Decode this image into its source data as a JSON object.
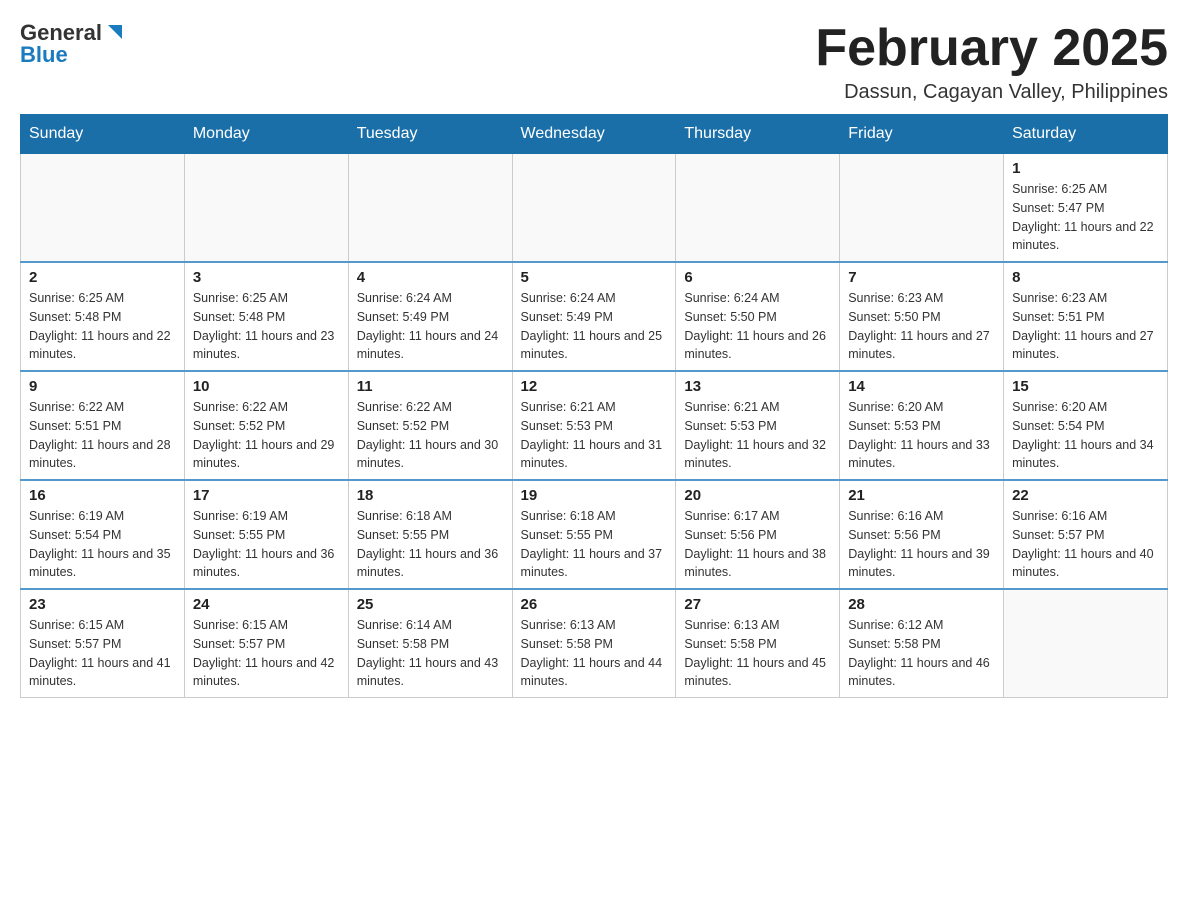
{
  "header": {
    "logo_general": "General",
    "logo_blue": "Blue",
    "month_title": "February 2025",
    "location": "Dassun, Cagayan Valley, Philippines"
  },
  "days_of_week": [
    "Sunday",
    "Monday",
    "Tuesday",
    "Wednesday",
    "Thursday",
    "Friday",
    "Saturday"
  ],
  "weeks": [
    [
      {
        "day": "",
        "info": ""
      },
      {
        "day": "",
        "info": ""
      },
      {
        "day": "",
        "info": ""
      },
      {
        "day": "",
        "info": ""
      },
      {
        "day": "",
        "info": ""
      },
      {
        "day": "",
        "info": ""
      },
      {
        "day": "1",
        "info": "Sunrise: 6:25 AM\nSunset: 5:47 PM\nDaylight: 11 hours and 22 minutes."
      }
    ],
    [
      {
        "day": "2",
        "info": "Sunrise: 6:25 AM\nSunset: 5:48 PM\nDaylight: 11 hours and 22 minutes."
      },
      {
        "day": "3",
        "info": "Sunrise: 6:25 AM\nSunset: 5:48 PM\nDaylight: 11 hours and 23 minutes."
      },
      {
        "day": "4",
        "info": "Sunrise: 6:24 AM\nSunset: 5:49 PM\nDaylight: 11 hours and 24 minutes."
      },
      {
        "day": "5",
        "info": "Sunrise: 6:24 AM\nSunset: 5:49 PM\nDaylight: 11 hours and 25 minutes."
      },
      {
        "day": "6",
        "info": "Sunrise: 6:24 AM\nSunset: 5:50 PM\nDaylight: 11 hours and 26 minutes."
      },
      {
        "day": "7",
        "info": "Sunrise: 6:23 AM\nSunset: 5:50 PM\nDaylight: 11 hours and 27 minutes."
      },
      {
        "day": "8",
        "info": "Sunrise: 6:23 AM\nSunset: 5:51 PM\nDaylight: 11 hours and 27 minutes."
      }
    ],
    [
      {
        "day": "9",
        "info": "Sunrise: 6:22 AM\nSunset: 5:51 PM\nDaylight: 11 hours and 28 minutes."
      },
      {
        "day": "10",
        "info": "Sunrise: 6:22 AM\nSunset: 5:52 PM\nDaylight: 11 hours and 29 minutes."
      },
      {
        "day": "11",
        "info": "Sunrise: 6:22 AM\nSunset: 5:52 PM\nDaylight: 11 hours and 30 minutes."
      },
      {
        "day": "12",
        "info": "Sunrise: 6:21 AM\nSunset: 5:53 PM\nDaylight: 11 hours and 31 minutes."
      },
      {
        "day": "13",
        "info": "Sunrise: 6:21 AM\nSunset: 5:53 PM\nDaylight: 11 hours and 32 minutes."
      },
      {
        "day": "14",
        "info": "Sunrise: 6:20 AM\nSunset: 5:53 PM\nDaylight: 11 hours and 33 minutes."
      },
      {
        "day": "15",
        "info": "Sunrise: 6:20 AM\nSunset: 5:54 PM\nDaylight: 11 hours and 34 minutes."
      }
    ],
    [
      {
        "day": "16",
        "info": "Sunrise: 6:19 AM\nSunset: 5:54 PM\nDaylight: 11 hours and 35 minutes."
      },
      {
        "day": "17",
        "info": "Sunrise: 6:19 AM\nSunset: 5:55 PM\nDaylight: 11 hours and 36 minutes."
      },
      {
        "day": "18",
        "info": "Sunrise: 6:18 AM\nSunset: 5:55 PM\nDaylight: 11 hours and 36 minutes."
      },
      {
        "day": "19",
        "info": "Sunrise: 6:18 AM\nSunset: 5:55 PM\nDaylight: 11 hours and 37 minutes."
      },
      {
        "day": "20",
        "info": "Sunrise: 6:17 AM\nSunset: 5:56 PM\nDaylight: 11 hours and 38 minutes."
      },
      {
        "day": "21",
        "info": "Sunrise: 6:16 AM\nSunset: 5:56 PM\nDaylight: 11 hours and 39 minutes."
      },
      {
        "day": "22",
        "info": "Sunrise: 6:16 AM\nSunset: 5:57 PM\nDaylight: 11 hours and 40 minutes."
      }
    ],
    [
      {
        "day": "23",
        "info": "Sunrise: 6:15 AM\nSunset: 5:57 PM\nDaylight: 11 hours and 41 minutes."
      },
      {
        "day": "24",
        "info": "Sunrise: 6:15 AM\nSunset: 5:57 PM\nDaylight: 11 hours and 42 minutes."
      },
      {
        "day": "25",
        "info": "Sunrise: 6:14 AM\nSunset: 5:58 PM\nDaylight: 11 hours and 43 minutes."
      },
      {
        "day": "26",
        "info": "Sunrise: 6:13 AM\nSunset: 5:58 PM\nDaylight: 11 hours and 44 minutes."
      },
      {
        "day": "27",
        "info": "Sunrise: 6:13 AM\nSunset: 5:58 PM\nDaylight: 11 hours and 45 minutes."
      },
      {
        "day": "28",
        "info": "Sunrise: 6:12 AM\nSunset: 5:58 PM\nDaylight: 11 hours and 46 minutes."
      },
      {
        "day": "",
        "info": ""
      }
    ]
  ]
}
